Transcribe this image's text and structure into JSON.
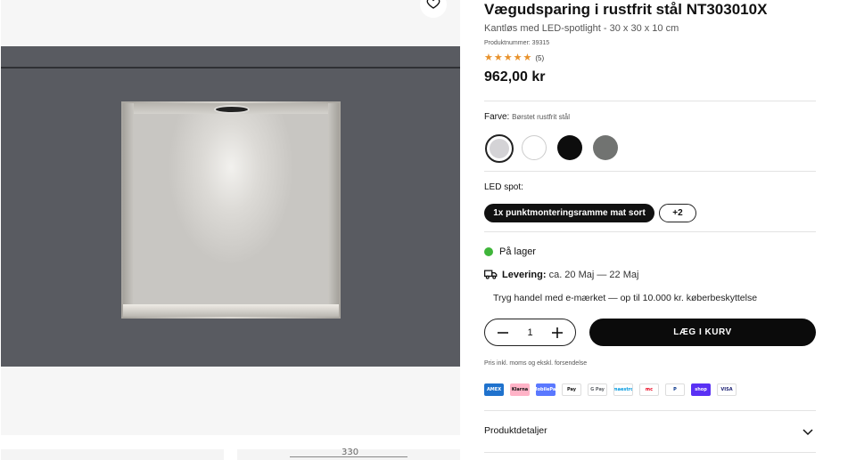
{
  "product": {
    "title": "Vægudsparing i rustfrit stål NT303010X",
    "subtitle": "Kantløs med LED-spotlight - 30 x 30 x 10 cm",
    "sku": "Produktnummer: 39315",
    "rating_stars": 5,
    "rating_count": "(5)",
    "price": "962,00 kr"
  },
  "gallery": {
    "dimension_label": "330"
  },
  "color": {
    "label": "Farve:",
    "value": "Børstet rustfrit stål",
    "swatches": [
      {
        "name": "Børstet rustfrit stål",
        "hex": "#d4d3d6",
        "selected": true
      },
      {
        "name": "Hvid",
        "hex": "#ffffff",
        "selected": false
      },
      {
        "name": "Sort",
        "hex": "#0d0d0d",
        "selected": false
      },
      {
        "name": "Grå",
        "hex": "#717371",
        "selected": false
      }
    ]
  },
  "led": {
    "label": "LED spot:",
    "selected_option": "1x punktmonteringsramme mat sort",
    "more_options": "+2"
  },
  "availability": {
    "stock": "På lager",
    "stock_color": "#3fb53a",
    "delivery_label": "Levering:",
    "delivery_value": "ca. 20 Maj — 22 Maj",
    "trust": "Tryg handel med e-mærket — op til 10.000 kr. køberbeskyttelse"
  },
  "purchase": {
    "quantity": "1",
    "add_to_cart": "LÆG I KURV",
    "vat_note": "Pris inkl. moms og ekskl. forsendelse"
  },
  "payment_methods": [
    {
      "name": "American Express",
      "label": "AMEX",
      "bg": "#1f72cd",
      "fg": "#ffffff"
    },
    {
      "name": "Klarna",
      "label": "Klarna",
      "bg": "#ffb3c7",
      "fg": "#111111"
    },
    {
      "name": "MobilePay",
      "label": "MobilePay",
      "bg": "#5a78ff",
      "fg": "#ffffff"
    },
    {
      "name": "Apple Pay",
      "label": "Pay",
      "bg": "#ffffff",
      "fg": "#111111"
    },
    {
      "name": "Google Pay",
      "label": "G Pay",
      "bg": "#ffffff",
      "fg": "#5f6368"
    },
    {
      "name": "Maestro",
      "label": "maestro",
      "bg": "#ffffff",
      "fg": "#0099df"
    },
    {
      "name": "Mastercard",
      "label": "mc",
      "bg": "#ffffff",
      "fg": "#eb001b"
    },
    {
      "name": "PayPal",
      "label": "P",
      "bg": "#ffffff",
      "fg": "#003087"
    },
    {
      "name": "Shop Pay",
      "label": "shop",
      "bg": "#5a31f4",
      "fg": "#ffffff"
    },
    {
      "name": "Visa",
      "label": "VISA",
      "bg": "#ffffff",
      "fg": "#1a1f71"
    }
  ],
  "accordion": {
    "details_label": "Produktdetaljer"
  }
}
